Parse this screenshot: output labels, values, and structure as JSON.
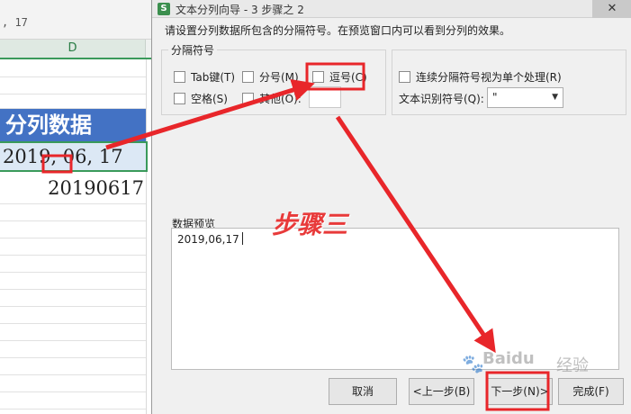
{
  "sheet": {
    "formula_value": ", 17",
    "column_label": "D",
    "header_cell": "分列数据",
    "selected_cell": "2019, 06, 17",
    "result_cell": "20190617"
  },
  "dialog": {
    "title": "文本分列向导 - 3 步骤之 2",
    "close_label": "✕",
    "instruction": "请设置分列数据所包含的分隔符号。在预览窗口内可以看到分列的效果。",
    "delimiters_legend": "分隔符号",
    "delimiters": [
      {
        "label": "Tab键(T)",
        "checked": false
      },
      {
        "label": "分号(M)",
        "checked": false
      },
      {
        "label": "逗号(C)",
        "checked": false
      },
      {
        "label": "空格(S)",
        "checked": false
      },
      {
        "label": "其他(O):",
        "checked": false
      }
    ],
    "other_value": "",
    "consecutive_label": "连续分隔符号视为单个处理(R)",
    "qualifier_label": "文本识别符号(Q):",
    "qualifier_value": "\"",
    "preview_label": "数据预览",
    "preview_text": "2019,06,17",
    "buttons": {
      "cancel": "取消",
      "back": "<上一步(B)",
      "next": "下一步(N)>",
      "finish": "完成(F)"
    }
  },
  "annotations": {
    "step_text": "步骤三",
    "color": "#e8262a",
    "watermark": "Baidu",
    "watermark_cn": "经验"
  }
}
